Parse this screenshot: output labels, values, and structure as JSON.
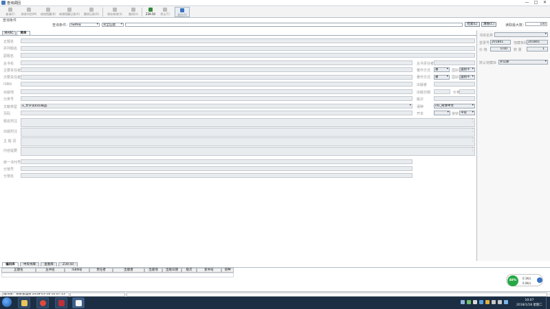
{
  "window": {
    "title": "查询调回",
    "min": "—",
    "max": "□",
    "close": "✕"
  },
  "toolbar": {
    "buttons": [
      {
        "label": "查询(F)"
      },
      {
        "label": "修改书目(M)"
      },
      {
        "label": "修改馆藏(B)"
      },
      {
        "label": "新增馆藏记录(A)"
      },
      {
        "label": "删除记录(D)"
      },
      {
        "label": "保存修改(S)"
      },
      {
        "label": "撤消(U)"
      },
      {
        "label": "Z39.50"
      },
      {
        "label": "停止(T)"
      },
      {
        "label": "退出(X)"
      }
    ]
  },
  "condition": {
    "group_label": "查询条件",
    "query_label": "查询条件：",
    "field_value": "ISBN号",
    "match_value": "完全匹配",
    "search_value": "",
    "search_button": "检索(L)",
    "reset_button": "清除(C)",
    "max_label": "读取最大数：",
    "max_value": "100"
  },
  "tabs": {
    "marc": "MARC",
    "simple": "简单"
  },
  "form": {
    "left_labels": [
      "正题名",
      "并列题名",
      "副题名",
      "丛书名",
      "主要责任者",
      "次要责任者",
      "ISBN",
      "出版地",
      "分类号",
      "文献类型",
      "页码",
      "题名附注",
      "出版附注",
      "主 题 词",
      "内容提要",
      "统一书刊号",
      "分馆号",
      "分馆名"
    ],
    "doc_type_value": "a_文字资料印刷品",
    "right_labels": [
      "丛书责任者",
      "著作方式",
      "著作方式",
      "出版者",
      "出版日期",
      "版次",
      "语种",
      "开本"
    ],
    "zhuzuo1_value": "著",
    "zhuzuo2_value": "著",
    "guobie_label": "国别",
    "guobie1_value": "国别不",
    "guobie2_value": "国别不",
    "price_label": "价格",
    "lang_value": "chi_简体中文",
    "format_value": "",
    "binding_label": "装帧",
    "binding_value": "平装"
  },
  "right_panel": {
    "book_library_label": "书库名称",
    "reg_no_label": "登录号",
    "reg_no_value": "201801",
    "barcode_label": "馆藏条码",
    "barcode_value": "201801",
    "price_label": "价 格",
    "price_value": "0.00",
    "qty_label": "数 量",
    "qty_value": "1",
    "collection_label": "默认馆藏库",
    "collection_value": "外公库"
  },
  "bottom_tabs": [
    "编目库",
    "中央书库",
    "查重库",
    "Z39.50"
  ],
  "grid_headers": [
    "正题名",
    "丛书名",
    "ISBN号",
    "责任者",
    "出版者",
    "出版地",
    "出版日期",
    "版次",
    "索书号",
    "语种"
  ],
  "status": {
    "text": "操作员：系统管理员 2018-01-18 10:07:13"
  },
  "net_widget": {
    "percent": "48%",
    "up": "0.1K/s",
    "down": "0.0K/s"
  },
  "clock": {
    "time": "10:07",
    "date": "2018/1/18 星期二"
  },
  "colors": {
    "taskbar": "#1b2e44",
    "accent": "#3b73c4",
    "green": "#28a745"
  }
}
